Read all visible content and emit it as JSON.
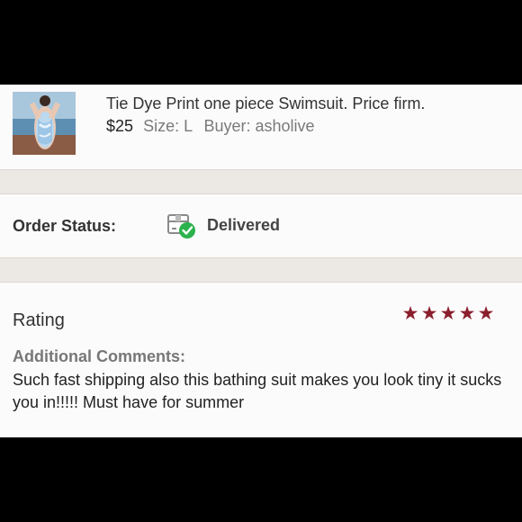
{
  "product": {
    "title": "Tie Dye Print one piece Swimsuit. Price firm.",
    "price": "$25",
    "size_label": "Size: L",
    "buyer_label": "Buyer: asholive",
    "thumbnail_icon": "swimsuit-photo"
  },
  "order": {
    "status_label": "Order Status:",
    "status_value": "Delivered",
    "status_icon": "delivered-box-check-icon",
    "status_color": "#2bb24c"
  },
  "review": {
    "rating_label": "Rating",
    "rating": 5,
    "max_rating": 5,
    "star_color": "#8b1e2d",
    "comments_label": "Additional Comments:",
    "comment": "Such fast shipping also this bathing suit makes you look tiny it sucks you in!!!!! Must have for summer"
  }
}
